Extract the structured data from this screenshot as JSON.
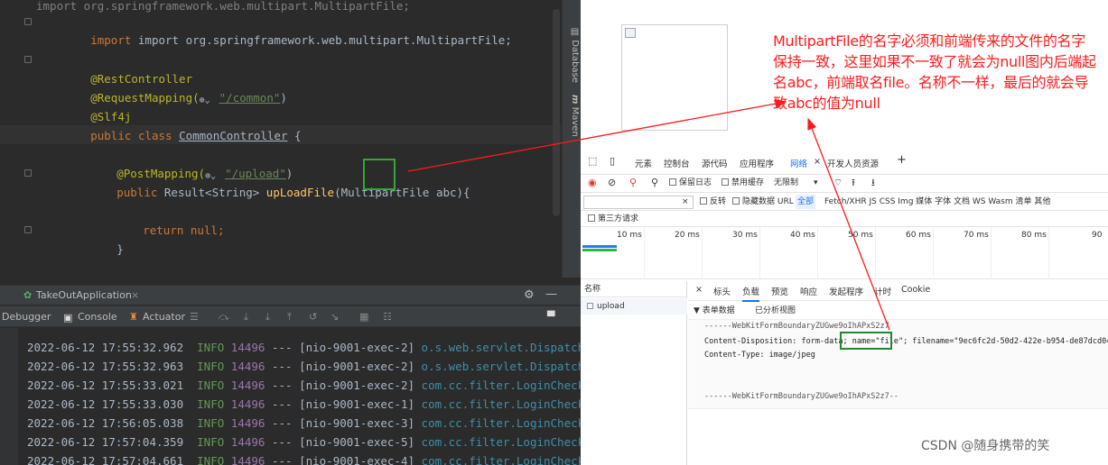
{
  "ide": {
    "code_lines": {
      "import_line": "import org.springframework.web.multipart.MultipartFile;",
      "rest_controller": "@RestController",
      "request_mapping_prefix": "@RequestMapping(",
      "request_mapping_path": "\"/common\"",
      "request_mapping_suffix": ")",
      "slf4j": "@Slf4j",
      "class_kw": "public class ",
      "class_name": "CommonController",
      "class_brace": " {",
      "post_mapping_prefix": "@PostMapping(",
      "post_mapping_path": "\"/upload\"",
      "post_mapping_suffix": ")",
      "method_kw": "public ",
      "method_type": "Result<String> ",
      "method_name": "upLoadFile",
      "method_params_prefix": "(MultipartFile ",
      "method_param_name": "abc",
      "method_params_suffix": "){",
      "return_kw": "return ",
      "return_val": "null;",
      "close_brace": "}"
    },
    "right_tabs": {
      "database": "Database",
      "maven": "Maven"
    },
    "run_panel": {
      "app_name": "TakeOutApplication",
      "tabs": {
        "debugger": "Debugger",
        "console": "Console",
        "actuator": "Actuator"
      }
    },
    "logs": [
      {
        "ts": "2022-06-12 17:55:32.962",
        "level": "INFO",
        "pid": "14496",
        "thread": "--- [nio-9001-exec-2]",
        "cls": "o.s.web.servlet.Dispatch"
      },
      {
        "ts": "2022-06-12 17:55:32.963",
        "level": "INFO",
        "pid": "14496",
        "thread": "--- [nio-9001-exec-2]",
        "cls": "o.s.web.servlet.Dispatch"
      },
      {
        "ts": "2022-06-12 17:55:33.021",
        "level": "INFO",
        "pid": "14496",
        "thread": "--- [nio-9001-exec-2]",
        "cls": "com.cc.filter.LoginCheck"
      },
      {
        "ts": "2022-06-12 17:55:33.030",
        "level": "INFO",
        "pid": "14496",
        "thread": "--- [nio-9001-exec-1]",
        "cls": "com.cc.filter.LoginCheck"
      },
      {
        "ts": "2022-06-12 17:56:05.038",
        "level": "INFO",
        "pid": "14496",
        "thread": "--- [nio-9001-exec-3]",
        "cls": "com.cc.filter.LoginCheck"
      },
      {
        "ts": "2022-06-12 17:57:04.359",
        "level": "INFO",
        "pid": "14496",
        "thread": "--- [nio-9001-exec-5]",
        "cls": "com.cc.filter.LoginCheck"
      },
      {
        "ts": "2022-06-12 17:57:04.661",
        "level": "INFO",
        "pid": "14496",
        "thread": "--- [nio-9001-exec-4]",
        "cls": "com.cc.filter.LoginCheck"
      }
    ]
  },
  "annotation_note": "MultipartFile的名字必须和前端传来的文件的名字保持一致，这里如果不一致了就会为null图内后端起名abc，前端取名file。名称不一样，最后的就会导致abc的值为null",
  "devtools": {
    "tabs": [
      "元素",
      "控制台",
      "源代码",
      "应用程序",
      "网络",
      "开发人员资源"
    ],
    "active_tab": "网络",
    "tab_close": "×",
    "add_tab": "+",
    "toolbar": {
      "preserve_log": "保留日志",
      "disable_cache": "禁用缓存",
      "throttle": "无限制"
    },
    "filter": {
      "invert": "反转",
      "hide_data_urls": "隐藏数据 URL",
      "all": "全部",
      "types": "Fetch/XHR  JS  CSS  Img  媒体  字体  文档  WS  Wasm  清单  其他"
    },
    "third_party": "第三方请求",
    "timeline_ticks": [
      "10 ms",
      "20 ms",
      "30 ms",
      "40 ms",
      "50 ms",
      "60 ms",
      "70 ms",
      "80 ms",
      "90"
    ],
    "names_header": "名称",
    "request_name": "upload",
    "detail_tabs": [
      "×",
      "标头",
      "负载",
      "预览",
      "响应",
      "发起程序",
      "计时",
      "Cookie"
    ],
    "active_detail_tab": "负载",
    "form_data_label": "▼ 表单数据",
    "view_parsed": "已分析视图",
    "payload": {
      "boundary_start": "------WebKitFormBoundaryZUGwe9oIhAPxS2z7",
      "content_disposition_prefix": "Content-Disposition: form-data; ",
      "name_field": "name=\"file\"",
      "filename_part": "; filename=\"9ec6fc2d-50d2-422e-b954-de87dcd041",
      "content_type": "Content-Type: image/jpeg",
      "boundary_end": "------WebKitFormBoundaryZUGwe9oIhAPxS2z7--"
    }
  },
  "watermark": "CSDN @随身携带的笑",
  "colors": {
    "annotation_red": "#ff1a1a",
    "highlight_green": "#3aa33a"
  }
}
